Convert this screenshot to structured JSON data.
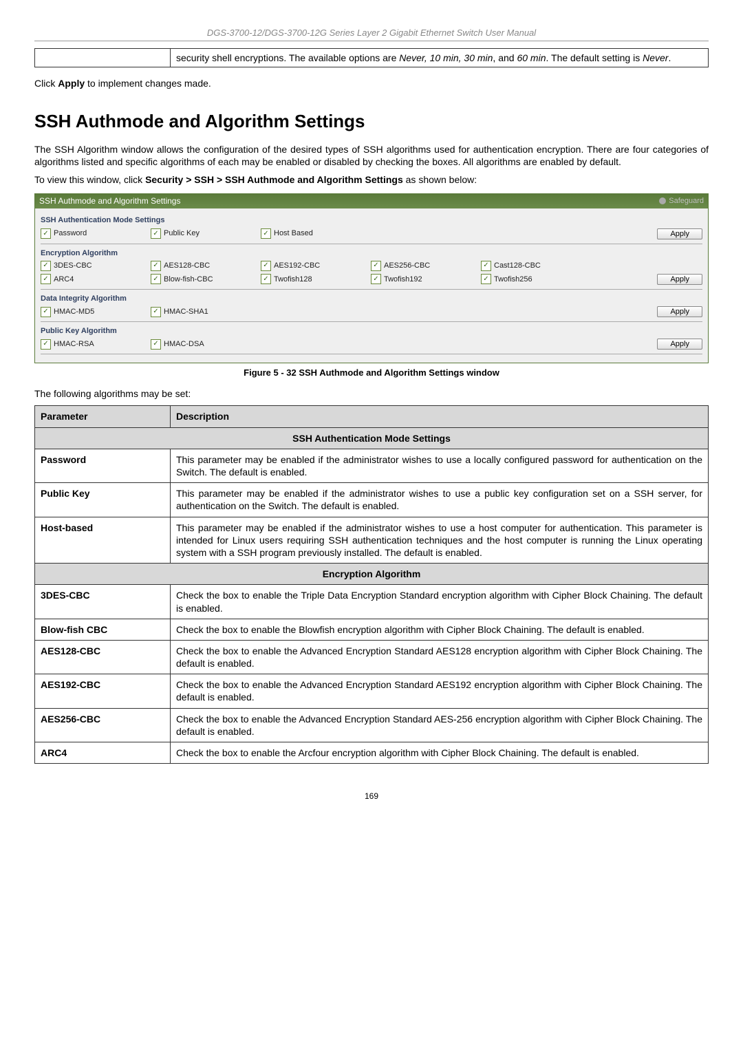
{
  "doc_header": "DGS-3700-12/DGS-3700-12G Series Layer 2 Gigabit Ethernet Switch User Manual",
  "top_cell_text_pre": "security shell encryptions. The available options are ",
  "top_cell_text_italic": "Never, 10 min, 30 min",
  "top_cell_text_and": ", and ",
  "top_cell_text_italic2": "60 min",
  "top_cell_text_post": ". The default setting is ",
  "top_cell_text_italic3": "Never",
  "top_cell_text_end": ".",
  "click_apply_pre": "Click ",
  "click_apply_bold": "Apply",
  "click_apply_post": " to implement changes made.",
  "section_title": "SSH Authmode and Algorithm Settings",
  "intro_paragraph": "The SSH Algorithm window allows the configuration of the desired types of SSH algorithms used for authentication encryption. There are four categories of algorithms listed and specific algorithms of each may be enabled or disabled by checking the boxes. All algorithms are enabled by default.",
  "nav_pre": "To view this window, click ",
  "nav_bold": "Security > SSH > SSH Authmode and Algorithm Settings",
  "nav_post": " as shown below:",
  "fw": {
    "title": "SSH Authmode and Algorithm Settings",
    "safeguard": "Safeguard",
    "apply": "Apply",
    "groups": {
      "auth": {
        "title": "SSH Authentication Mode Settings",
        "items": [
          "Password",
          "Public Key",
          "Host Based"
        ]
      },
      "enc": {
        "title": "Encryption Algorithm",
        "row1": [
          "3DES-CBC",
          "AES128-CBC",
          "AES192-CBC",
          "AES256-CBC",
          "Cast128-CBC"
        ],
        "row2": [
          "ARC4",
          "Blow-fish-CBC",
          "Twofish128",
          "Twofish192",
          "Twofish256"
        ]
      },
      "integ": {
        "title": "Data Integrity Algorithm",
        "items": [
          "HMAC-MD5",
          "HMAC-SHA1"
        ]
      },
      "pub": {
        "title": "Public Key Algorithm",
        "items": [
          "HMAC-RSA",
          "HMAC-DSA"
        ]
      }
    }
  },
  "figure_caption": "Figure 5 - 32 SSH Authmode and Algorithm Settings window",
  "algos_intro": "The following algorithms may be set:",
  "table": {
    "head_param": "Parameter",
    "head_desc": "Description",
    "section1": "SSH Authentication Mode Settings",
    "rows1": [
      {
        "name": "Password",
        "desc": "This parameter may be enabled if the administrator wishes to use a locally configured password for authentication on the Switch. The default is enabled."
      },
      {
        "name": "Public Key",
        "desc": "This parameter may be enabled if the administrator wishes to use a public key configuration set on a SSH server, for authentication on the Switch. The default is enabled."
      },
      {
        "name": "Host-based",
        "desc": "This parameter may be enabled if the administrator wishes to use a host computer for authentication. This parameter is intended for Linux users requiring SSH authentication techniques and the host computer is running the Linux operating system with a SSH program previously installed. The default is enabled."
      }
    ],
    "section2": "Encryption Algorithm",
    "rows2": [
      {
        "name": "3DES-CBC",
        "desc": "Check the box to enable the Triple Data Encryption Standard encryption algorithm with Cipher Block Chaining. The default is enabled."
      },
      {
        "name": "Blow-fish CBC",
        "desc": "Check the box to enable the Blowfish encryption algorithm with Cipher Block Chaining. The default is enabled."
      },
      {
        "name": "AES128-CBC",
        "desc": "Check the box to enable the Advanced Encryption Standard AES128 encryption algorithm with Cipher Block Chaining. The default is enabled."
      },
      {
        "name": "AES192-CBC",
        "desc": "Check the box to enable the Advanced Encryption Standard AES192 encryption algorithm with Cipher Block Chaining. The default is enabled."
      },
      {
        "name": "AES256-CBC",
        "desc": "Check the box to enable the Advanced Encryption Standard AES-256 encryption algorithm with Cipher Block Chaining. The default is enabled."
      },
      {
        "name": "ARC4",
        "desc": "Check the box to enable the Arcfour encryption algorithm with Cipher Block Chaining. The default is enabled."
      }
    ]
  },
  "page_number": "169"
}
